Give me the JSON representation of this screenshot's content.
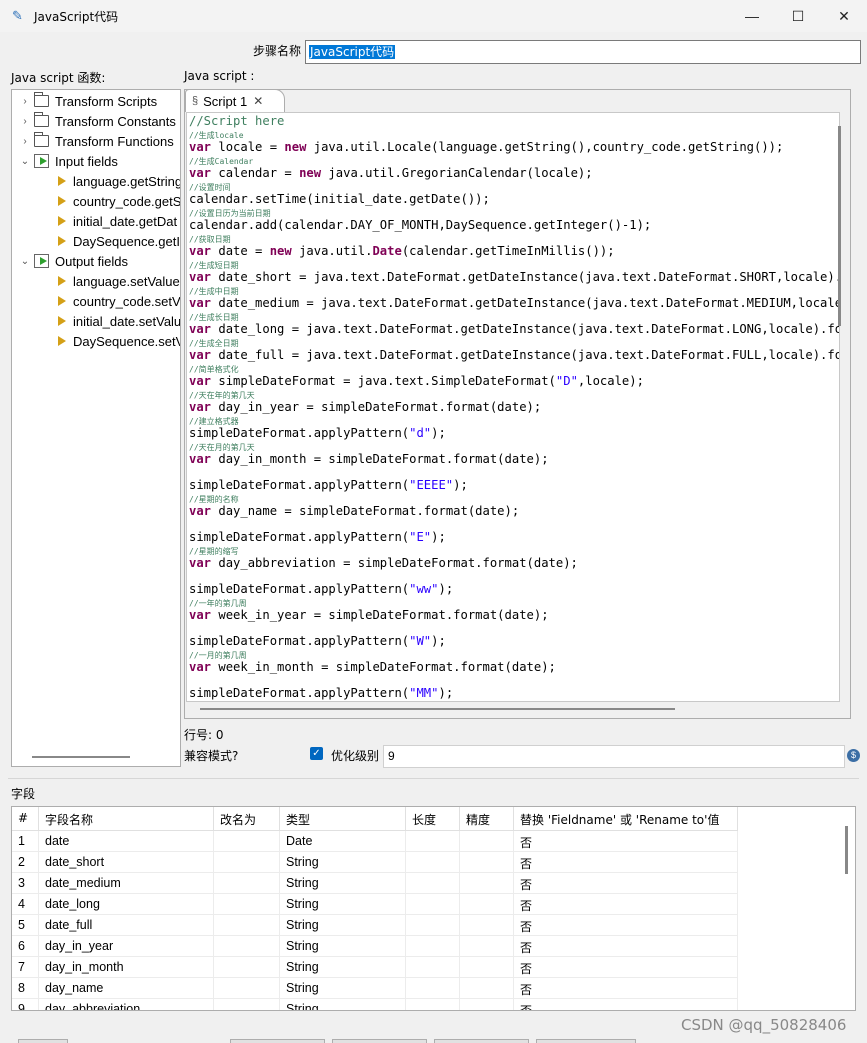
{
  "window": {
    "title": "JavaScript代码",
    "minimize": "—",
    "maximize": "☐",
    "close": "✕"
  },
  "step": {
    "label": "步骤名称",
    "value": "JavaScript代码"
  },
  "left_panel": {
    "label": "Java script 函数:",
    "tree": [
      {
        "label": "Transform Scripts",
        "type": "folder",
        "expandable": true
      },
      {
        "label": "Transform Constants",
        "type": "folder",
        "expandable": true
      },
      {
        "label": "Transform Functions",
        "type": "folder",
        "expandable": true
      },
      {
        "label": "Input fields",
        "type": "input",
        "expanded": true
      },
      {
        "label": "language.getString",
        "type": "field"
      },
      {
        "label": "country_code.getS",
        "type": "field"
      },
      {
        "label": "initial_date.getDat",
        "type": "field"
      },
      {
        "label": "DaySequence.getI",
        "type": "field"
      },
      {
        "label": "Output fields",
        "type": "output",
        "expanded": true
      },
      {
        "label": "language.setValue",
        "type": "field"
      },
      {
        "label": "country_code.setV",
        "type": "field"
      },
      {
        "label": "initial_date.setValu",
        "type": "field"
      },
      {
        "label": "DaySequence.setV",
        "type": "field"
      }
    ]
  },
  "editor": {
    "label": "Java script :",
    "tab_label": "Script 1",
    "lines": [
      [
        [
          "c",
          "//Script here"
        ]
      ],
      [
        [
          "s",
          "//生成locale"
        ]
      ],
      [
        [
          "k",
          "var"
        ],
        [
          "p",
          " locale = "
        ],
        [
          "k",
          "new"
        ],
        [
          "p",
          " java.util.Locale(language.getString(),country_code.getString());"
        ]
      ],
      [
        [
          "s",
          "//生成Calendar"
        ]
      ],
      [
        [
          "k",
          "var"
        ],
        [
          "p",
          " calendar = "
        ],
        [
          "k",
          "new"
        ],
        [
          "p",
          " java.util.GregorianCalendar(locale);"
        ]
      ],
      [
        [
          "s",
          "//设置时间"
        ]
      ],
      [
        [
          "p",
          "calendar.setTime(initial_date.getDate());"
        ]
      ],
      [
        [
          "s",
          "//设置日历为当前日期"
        ]
      ],
      [
        [
          "p",
          "calendar.add(calendar.DAY_OF_MONTH,DaySequence.getInteger()-1);"
        ]
      ],
      [
        [
          "s",
          "//获取日期"
        ]
      ],
      [
        [
          "k",
          "var"
        ],
        [
          "p",
          " date = "
        ],
        [
          "k",
          "new"
        ],
        [
          "p",
          " java.util."
        ],
        [
          "k",
          "Date"
        ],
        [
          "p",
          "(calendar.getTimeInMillis());"
        ]
      ],
      [
        [
          "s",
          "//生成短日期"
        ]
      ],
      [
        [
          "k",
          "var"
        ],
        [
          "p",
          " date_short = java.text.DateFormat.getDateInstance(java.text.DateFormat.SHORT,locale).format(date);"
        ]
      ],
      [
        [
          "s",
          "//生成中日期"
        ]
      ],
      [
        [
          "k",
          "var"
        ],
        [
          "p",
          " date_medium = java.text.DateFormat.getDateInstance(java.text.DateFormat.MEDIUM,locale).format(date);"
        ]
      ],
      [
        [
          "s",
          "//生成长日期"
        ]
      ],
      [
        [
          "k",
          "var"
        ],
        [
          "p",
          " date_long = java.text.DateFormat.getDateInstance(java.text.DateFormat.LONG,locale).format(date);"
        ]
      ],
      [
        [
          "s",
          "//生成全日期"
        ]
      ],
      [
        [
          "k",
          "var"
        ],
        [
          "p",
          " date_full = java.text.DateFormat.getDateInstance(java.text.DateFormat.FULL,locale).format(date);"
        ]
      ],
      [
        [
          "s",
          "//简单格式化"
        ]
      ],
      [
        [
          "k",
          "var"
        ],
        [
          "p",
          " simpleDateFormat = java.text.SimpleDateFormat("
        ],
        [
          "q",
          "\"D\""
        ],
        [
          "p",
          ",locale);"
        ]
      ],
      [
        [
          "s",
          "//天在年的第几天"
        ]
      ],
      [
        [
          "k",
          "var"
        ],
        [
          "p",
          " day_in_year = simpleDateFormat.format(date);"
        ]
      ],
      [
        [
          "s",
          "//建立格式器"
        ]
      ],
      [
        [
          "p",
          "simpleDateFormat.applyPattern("
        ],
        [
          "q",
          "\"d\""
        ],
        [
          "p",
          ");"
        ]
      ],
      [
        [
          "s",
          "//天在月的第几天"
        ]
      ],
      [
        [
          "k",
          "var"
        ],
        [
          "p",
          " day_in_month = simpleDateFormat.format(date);"
        ]
      ],
      [],
      [
        [
          "p",
          "simpleDateFormat.applyPattern("
        ],
        [
          "q",
          "\"EEEE\""
        ],
        [
          "p",
          ");"
        ]
      ],
      [
        [
          "s",
          "//星期的名称"
        ]
      ],
      [
        [
          "k",
          "var"
        ],
        [
          "p",
          " day_name = simpleDateFormat.format(date);"
        ]
      ],
      [],
      [
        [
          "p",
          "simpleDateFormat.applyPattern("
        ],
        [
          "q",
          "\"E\""
        ],
        [
          "p",
          ");"
        ]
      ],
      [
        [
          "s",
          "//星期的缩写"
        ]
      ],
      [
        [
          "k",
          "var"
        ],
        [
          "p",
          " day_abbreviation = simpleDateFormat.format(date);"
        ]
      ],
      [],
      [
        [
          "p",
          "simpleDateFormat.applyPattern("
        ],
        [
          "q",
          "\"ww\""
        ],
        [
          "p",
          ");"
        ]
      ],
      [
        [
          "s",
          "//一年的第几周"
        ]
      ],
      [
        [
          "k",
          "var"
        ],
        [
          "p",
          " week_in_year = simpleDateFormat.format(date);"
        ]
      ],
      [],
      [
        [
          "p",
          "simpleDateFormat.applyPattern("
        ],
        [
          "q",
          "\"W\""
        ],
        [
          "p",
          ");"
        ]
      ],
      [
        [
          "s",
          "//一月的第几周"
        ]
      ],
      [
        [
          "k",
          "var"
        ],
        [
          "p",
          " week_in_month = simpleDateFormat.format(date);"
        ]
      ],
      [],
      [
        [
          "p",
          "simpleDateFormat.applyPattern("
        ],
        [
          "q",
          "\"MM\""
        ],
        [
          "p",
          ");"
        ]
      ]
    ]
  },
  "status": {
    "line_no": "行号: 0",
    "compat_label": "兼容模式?",
    "optimize_label": "优化级别",
    "optimize_value": "9"
  },
  "fields": {
    "label": "字段",
    "columns": [
      "#",
      "字段名称",
      "改名为",
      "类型",
      "长度",
      "精度",
      "替换 'Fieldname' 或 'Rename to'值"
    ],
    "rows": [
      [
        "1",
        "date",
        "",
        "Date",
        "",
        "",
        "否"
      ],
      [
        "2",
        "date_short",
        "",
        "String",
        "",
        "",
        "否"
      ],
      [
        "3",
        "date_medium",
        "",
        "String",
        "",
        "",
        "否"
      ],
      [
        "4",
        "date_long",
        "",
        "String",
        "",
        "",
        "否"
      ],
      [
        "5",
        "date_full",
        "",
        "String",
        "",
        "",
        "否"
      ],
      [
        "6",
        "day_in_year",
        "",
        "String",
        "",
        "",
        "否"
      ],
      [
        "7",
        "day_in_month",
        "",
        "String",
        "",
        "",
        "否"
      ],
      [
        "8",
        "day_name",
        "",
        "String",
        "",
        "",
        "否"
      ],
      [
        "9",
        "day_abbreviation",
        "",
        "String",
        "",
        "",
        "否"
      ]
    ]
  },
  "watermark": "CSDN @qq_50828406"
}
